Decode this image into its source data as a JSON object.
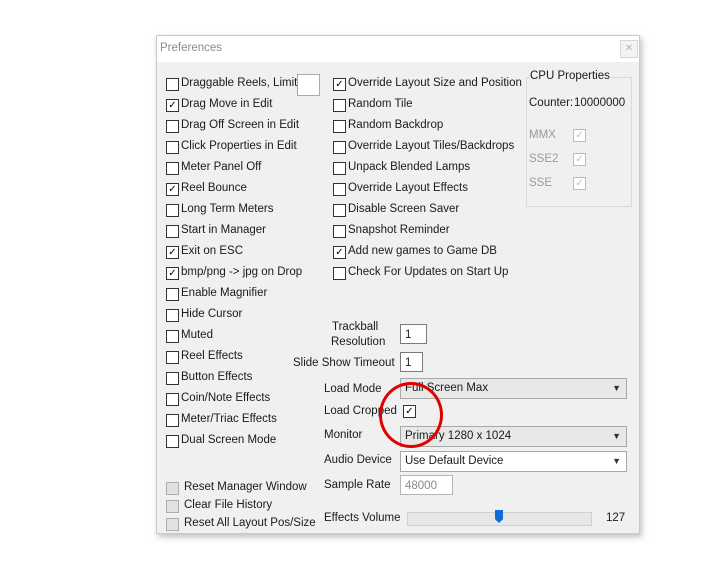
{
  "window": {
    "title": "Preferences",
    "close_glyph": "✕"
  },
  "left_column": [
    {
      "label": "Draggable Reels, Limit:",
      "checked": false
    },
    {
      "label": "Drag Move in Edit",
      "checked": true
    },
    {
      "label": "Drag Off Screen in Edit",
      "checked": false
    },
    {
      "label": "Click Properties in Edit",
      "checked": false
    },
    {
      "label": "Meter Panel Off",
      "checked": false
    },
    {
      "label": "Reel Bounce",
      "checked": true
    },
    {
      "label": "Long Term Meters",
      "checked": false
    },
    {
      "label": "Start in Manager",
      "checked": false
    },
    {
      "label": "Exit on ESC",
      "checked": true
    },
    {
      "label": "bmp/png -> jpg on Drop",
      "checked": true
    },
    {
      "label": "Enable Magnifier",
      "checked": false
    },
    {
      "label": "Hide Cursor",
      "checked": false
    },
    {
      "label": "Muted",
      "checked": false
    },
    {
      "label": "Reel Effects",
      "checked": false
    },
    {
      "label": "Button Effects",
      "checked": false
    },
    {
      "label": "Coin/Note Effects",
      "checked": false
    },
    {
      "label": "Meter/Triac Effects",
      "checked": false
    },
    {
      "label": "Dual Screen Mode",
      "checked": false
    }
  ],
  "middle_column": [
    {
      "label": "Override Layout Size and Position",
      "checked": true
    },
    {
      "label": "Random Tile",
      "checked": false
    },
    {
      "label": "Random Backdrop",
      "checked": false
    },
    {
      "label": "Override Layout Tiles/Backdrops",
      "checked": false
    },
    {
      "label": "Unpack Blended Lamps",
      "checked": false
    },
    {
      "label": "Override Layout Effects",
      "checked": false
    },
    {
      "label": "Disable Screen Saver",
      "checked": false
    },
    {
      "label": "Snapshot Reminder",
      "checked": false
    },
    {
      "label": "Add new games to Game DB",
      "checked": true
    },
    {
      "label": "Check For Updates on Start Up",
      "checked": false
    }
  ],
  "cpu": {
    "title": "CPU Properties",
    "counter_label": "Counter:",
    "counter_value": "10000000",
    "features": [
      {
        "label": "MMX",
        "checked": true
      },
      {
        "label": "SSE2",
        "checked": true
      },
      {
        "label": "SSE",
        "checked": true
      }
    ]
  },
  "trackball": {
    "label_line1": "Trackball",
    "label_line2": "Resolution",
    "value": "1"
  },
  "slideshow": {
    "label": "Slide Show Timeout",
    "value": "1"
  },
  "load_mode": {
    "label": "Load Mode",
    "value": "Full Screen Max"
  },
  "load_cropped": {
    "label": "Load Cropped",
    "checked": true
  },
  "monitor": {
    "label": "Monitor",
    "value": "Primary 1280 x 1024"
  },
  "audio_device": {
    "label": "Audio Device",
    "value": "Use Default Device"
  },
  "sample_rate": {
    "label": "Sample Rate",
    "value": "48000"
  },
  "effects_volume": {
    "label": "Effects Volume",
    "value": "127",
    "level": 127,
    "max": 255
  },
  "bottom_buttons": [
    {
      "label": "Reset Manager Window"
    },
    {
      "label": "Clear File History"
    },
    {
      "label": "Reset All Layout Pos/Size"
    }
  ],
  "check_glyph": "✓",
  "dropdown_glyph": "▼",
  "colors": {
    "highlight_circle": "#e00000",
    "slider_thumb": "#0a6fd6"
  }
}
